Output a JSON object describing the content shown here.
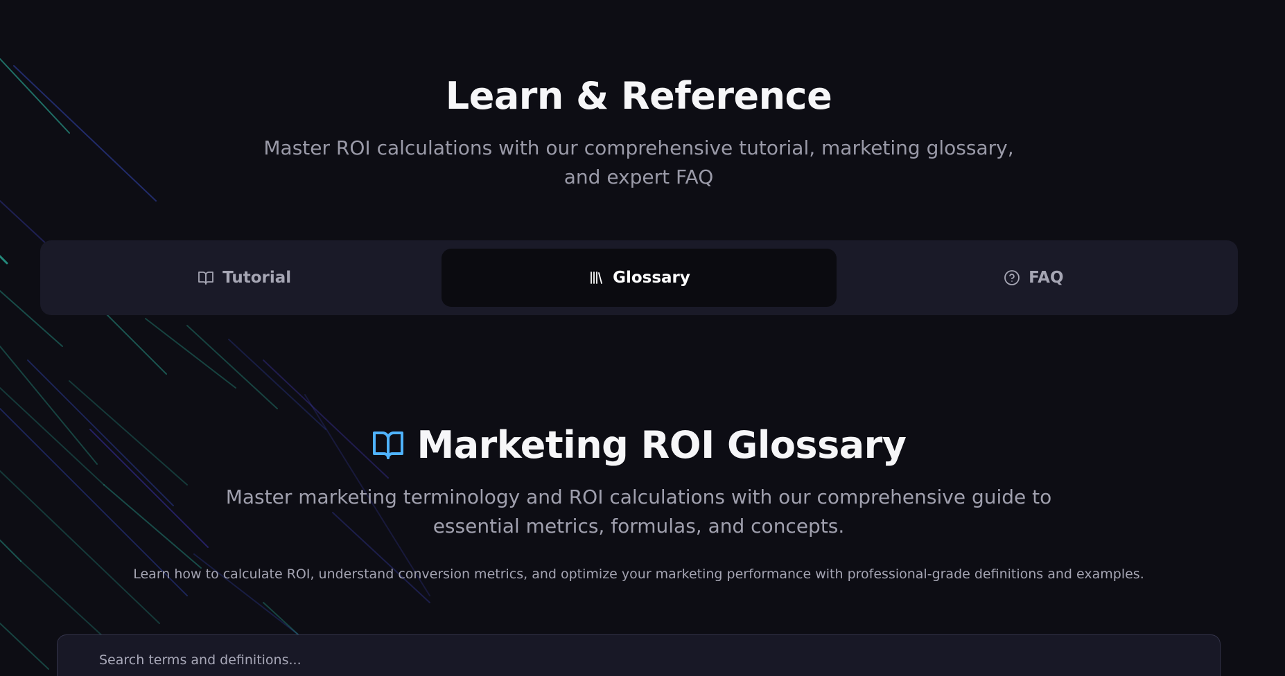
{
  "hero": {
    "title": "Learn & Reference",
    "subtitle": "Master ROI calculations with our comprehensive tutorial, marketing glossary, and expert FAQ"
  },
  "tabs": [
    {
      "label": "Tutorial",
      "icon": "book-open-icon",
      "active": false
    },
    {
      "label": "Glossary",
      "icon": "library-icon",
      "active": true
    },
    {
      "label": "FAQ",
      "icon": "help-circle-icon",
      "active": false
    }
  ],
  "glossary": {
    "icon": "book-open-icon",
    "title": "Marketing ROI Glossary",
    "subtitle": "Master marketing terminology and ROI calculations with our comprehensive guide to essential metrics, formulas, and concepts.",
    "note": "Learn how to calculate ROI, understand conversion metrics, and optimize your marketing performance with professional-grade definitions and examples.",
    "search": {
      "placeholder": "Search terms and definitions...",
      "value": ""
    }
  },
  "colors": {
    "background": "#0d0d14",
    "tab_bar": "#1a1a28",
    "tab_active": "#0b0b10",
    "accent_icon": "#4fb3ff",
    "streak_teal": "#2fbfa8",
    "streak_indigo": "#4b3fd8"
  }
}
